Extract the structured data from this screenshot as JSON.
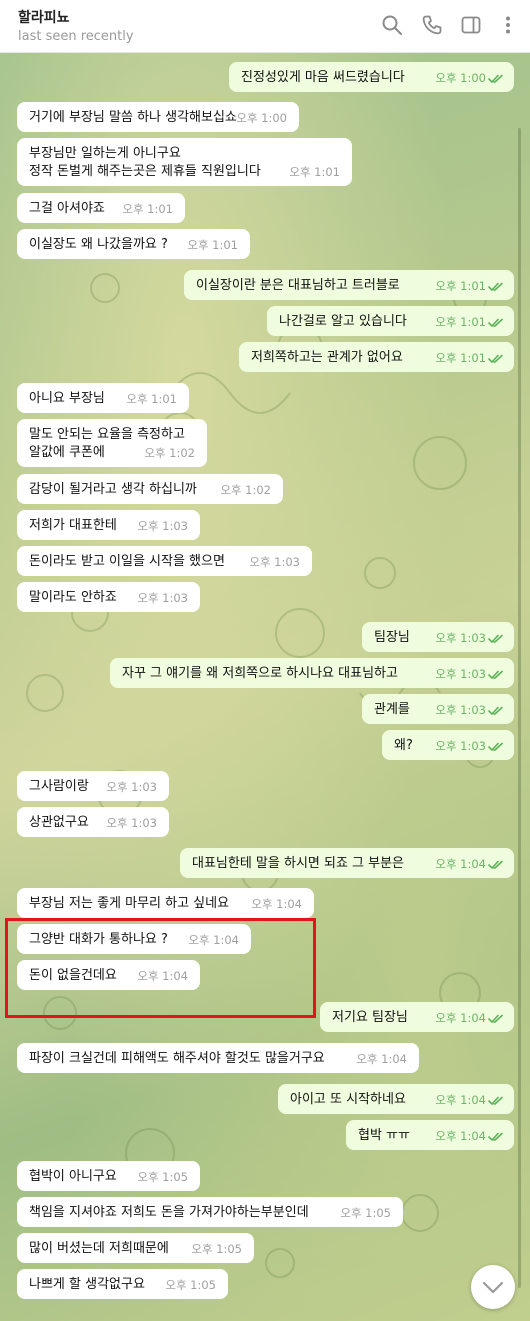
{
  "header": {
    "title": "할라피뇨",
    "status": "last seen recently"
  },
  "icons": {
    "search": "search-icon",
    "call": "phone-icon",
    "sidebar": "sidebar-toggle-icon",
    "more": "more-icon",
    "down": "chevron-down-icon"
  },
  "colors": {
    "incoming": "#ffffff",
    "outgoing": "#effdde",
    "check": "#5fb05a",
    "highlight": "#e3141b"
  },
  "messages": [
    {
      "dir": "out",
      "text": "진정성있게 마음 써드렸습니다",
      "time": "오후 1:00"
    },
    {
      "dir": "in",
      "text": "거기에 부장님 말씀 하나 생각해보십쇼",
      "time": "오후 1:00"
    },
    {
      "dir": "in",
      "text": "부장님만 일하는게 아니구요\n정작 돈벌게 해주는곳은 제휴들 직원입니다",
      "time": "오후 1:01"
    },
    {
      "dir": "in",
      "text": "그걸 아셔야죠",
      "time": "오후 1:01"
    },
    {
      "dir": "in",
      "text": "이실장도 왜 나갔을까요 ?",
      "time": "오후 1:01"
    },
    {
      "dir": "out",
      "text": "이실장이란 분은 대표님하고 트러블로",
      "time": "오후 1:01"
    },
    {
      "dir": "out",
      "text": "나간걸로 알고 있습니다",
      "time": "오후 1:01"
    },
    {
      "dir": "out",
      "text": "저희쪽하고는 관계가 없어요",
      "time": "오후 1:01"
    },
    {
      "dir": "in",
      "text": "아니요 부장님",
      "time": "오후 1:01"
    },
    {
      "dir": "in",
      "text": "말도 안되는 요율을 측정하고\n알값에 쿠폰에",
      "time": "오후 1:02"
    },
    {
      "dir": "in",
      "text": "감당이 될거라고 생각 하십니까",
      "time": "오후 1:02"
    },
    {
      "dir": "in",
      "text": "저희가 대표한테",
      "time": "오후 1:03"
    },
    {
      "dir": "in",
      "text": "돈이라도 받고 이일을 시작을 했으면",
      "time": "오후 1:03"
    },
    {
      "dir": "in",
      "text": "말이라도 안하죠",
      "time": "오후 1:03"
    },
    {
      "dir": "out",
      "text": "팀장님",
      "time": "오후 1:03"
    },
    {
      "dir": "out",
      "text": "자꾸 그 얘기를 왜 저희쪽으로 하시나요 대표님하고",
      "time": "오후 1:03"
    },
    {
      "dir": "out",
      "text": "관계를",
      "time": "오후 1:03"
    },
    {
      "dir": "out",
      "text": "왜?",
      "time": "오후 1:03"
    },
    {
      "dir": "in",
      "text": "그사람이랑",
      "time": "오후 1:03"
    },
    {
      "dir": "in",
      "text": "상관없구요",
      "time": "오후 1:03"
    },
    {
      "dir": "out",
      "text": "대표님한테 말을 하시면 되죠 그 부분은",
      "time": "오후 1:04"
    },
    {
      "dir": "in",
      "text": "부장님 저는 좋게 마무리 하고 싶네요",
      "time": "오후 1:04"
    },
    {
      "dir": "in",
      "text": "그양반 대화가 통하나요 ?",
      "time": "오후 1:04"
    },
    {
      "dir": "in",
      "text": "돈이 없을건데요",
      "time": "오후 1:04"
    },
    {
      "dir": "out",
      "text": "저기요 팀장님",
      "time": "오후 1:04"
    },
    {
      "dir": "in",
      "text": "파장이 크실건데 피해액도 해주셔야 할것도 많을거구요",
      "time": "오후 1:04"
    },
    {
      "dir": "out",
      "text": "아이고 또 시작하네요",
      "time": "오후 1:04"
    },
    {
      "dir": "out",
      "text": "협박 ㅠㅠ",
      "time": "오후 1:04"
    },
    {
      "dir": "in",
      "text": "협박이 아니구요",
      "time": "오후 1:05"
    },
    {
      "dir": "in",
      "text": "책임을 지셔야죠 저희도 돈을 가져가야하는부분인데",
      "time": "오후 1:05"
    },
    {
      "dir": "in",
      "text": "많이 버셨는데 저희때문에",
      "time": "오후 1:05"
    },
    {
      "dir": "in",
      "text": "나쁘게 할 생각없구요",
      "time": "오후 1:05"
    }
  ]
}
